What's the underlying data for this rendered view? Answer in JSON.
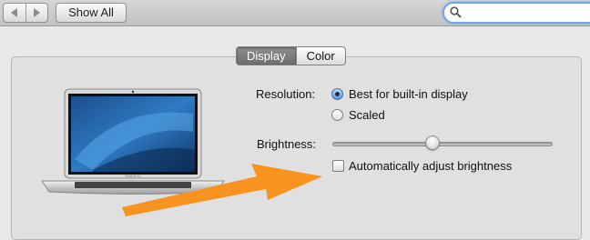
{
  "toolbar": {
    "back_icon": "chevron-left-icon",
    "forward_icon": "chevron-right-icon",
    "show_all_label": "Show All",
    "search_value": "",
    "search_icon": "magnifier-icon"
  },
  "tabs": [
    {
      "label": "Display",
      "active": true
    },
    {
      "label": "Color",
      "active": false
    }
  ],
  "resolution": {
    "label": "Resolution:",
    "options": [
      {
        "label": "Best for built-in display",
        "selected": true
      },
      {
        "label": "Scaled",
        "selected": false
      }
    ]
  },
  "brightness": {
    "label": "Brightness:",
    "level": 0.45
  },
  "auto_brightness": {
    "label": "Automatically adjust brightness",
    "checked": false
  },
  "laptop_brand": "MacBook Air",
  "colors": {
    "arrow": "#f7931e",
    "search_focus": "#6fa6e8",
    "active_tab": "#7a7a7a"
  }
}
